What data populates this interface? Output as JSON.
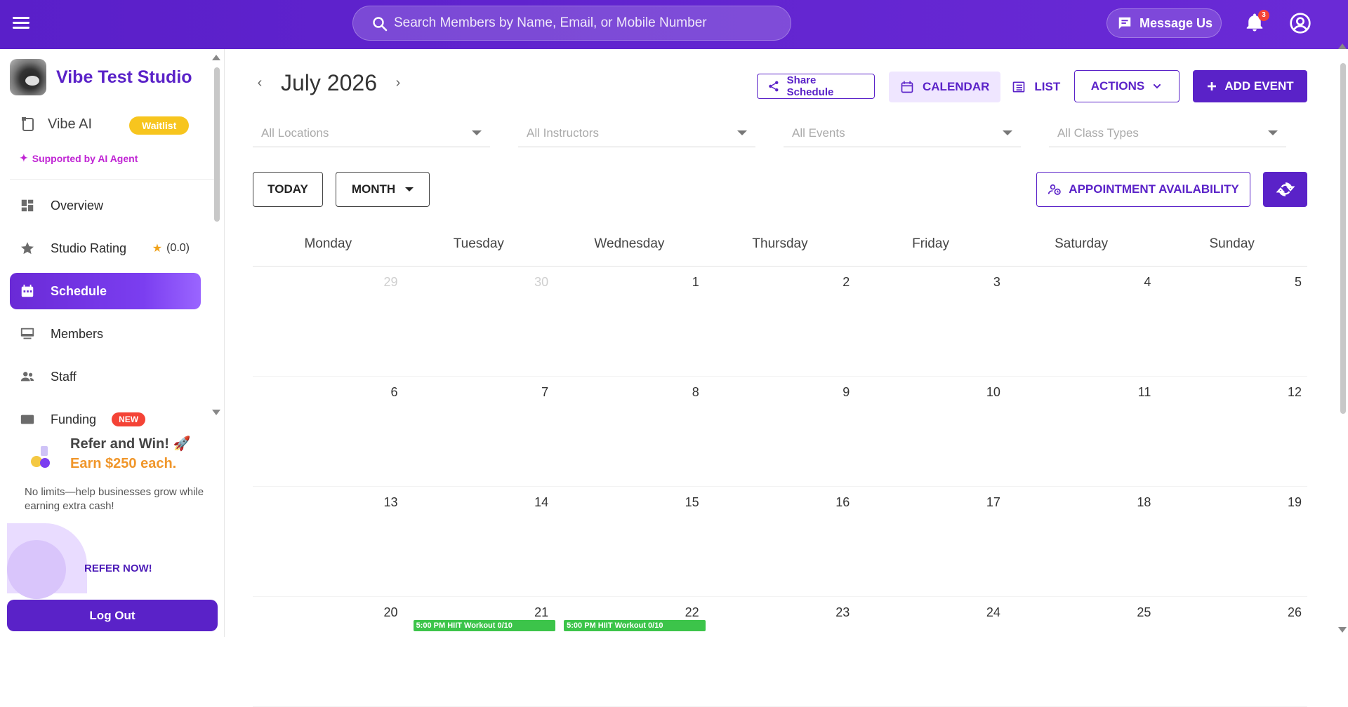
{
  "topbar": {
    "search_placeholder": "Search Members by Name, Email, or Mobile Number",
    "message_label": "Message Us",
    "notification_count": "3"
  },
  "sidebar": {
    "studio_name": "Vibe Test Studio",
    "vibe_ai_label": "Vibe AI",
    "waitlist_label": "Waitlist",
    "supported_label": "Supported by AI Agent",
    "items": [
      {
        "label": "Overview",
        "icon": "dashboard-icon"
      },
      {
        "label": "Studio Rating",
        "icon": "star-icon",
        "rating": "(0.0)"
      },
      {
        "label": "Schedule",
        "icon": "calendar-icon",
        "active": true
      },
      {
        "label": "Members",
        "icon": "monitor-icon"
      },
      {
        "label": "Staff",
        "icon": "people-icon"
      },
      {
        "label": "Funding",
        "icon": "funding-icon",
        "badge": "NEW"
      }
    ],
    "refer": {
      "title": "Refer and Win! 🚀",
      "earn": "Earn $250 each.",
      "desc": "No limits—help businesses grow while earning extra cash!",
      "cta": "REFER NOW!"
    },
    "logout_label": "Log Out"
  },
  "schedule": {
    "month_title": "July 2026",
    "share_label": "Share Schedule",
    "calendar_label": "CALENDAR",
    "list_label": "LIST",
    "actions_label": "ACTIONS",
    "add_event_label": "ADD EVENT",
    "filters": [
      "All Locations",
      "All Instructors",
      "All Events",
      "All Class Types"
    ],
    "today_label": "TODAY",
    "month_label": "MONTH",
    "appointment_label": "APPOINTMENT AVAILABILITY",
    "weekdays": [
      "Monday",
      "Tuesday",
      "Wednesday",
      "Thursday",
      "Friday",
      "Saturday",
      "Sunday"
    ],
    "weeks": [
      [
        {
          "d": "29",
          "muted": true
        },
        {
          "d": "30",
          "muted": true
        },
        {
          "d": "1"
        },
        {
          "d": "2"
        },
        {
          "d": "3"
        },
        {
          "d": "4"
        },
        {
          "d": "5"
        }
      ],
      [
        {
          "d": "6"
        },
        {
          "d": "7"
        },
        {
          "d": "8"
        },
        {
          "d": "9"
        },
        {
          "d": "10"
        },
        {
          "d": "11"
        },
        {
          "d": "12"
        }
      ],
      [
        {
          "d": "13"
        },
        {
          "d": "14"
        },
        {
          "d": "15"
        },
        {
          "d": "16"
        },
        {
          "d": "17"
        },
        {
          "d": "18"
        },
        {
          "d": "19"
        }
      ],
      [
        {
          "d": "20"
        },
        {
          "d": "21",
          "event": "5:00 PM HIIT Workout 0/10"
        },
        {
          "d": "22",
          "event": "5:00 PM HIIT Workout 0/10"
        },
        {
          "d": "23"
        },
        {
          "d": "24"
        },
        {
          "d": "25"
        },
        {
          "d": "26"
        }
      ]
    ],
    "colors": {
      "accent": "#5a22c8",
      "event": "#3cc44a"
    }
  }
}
